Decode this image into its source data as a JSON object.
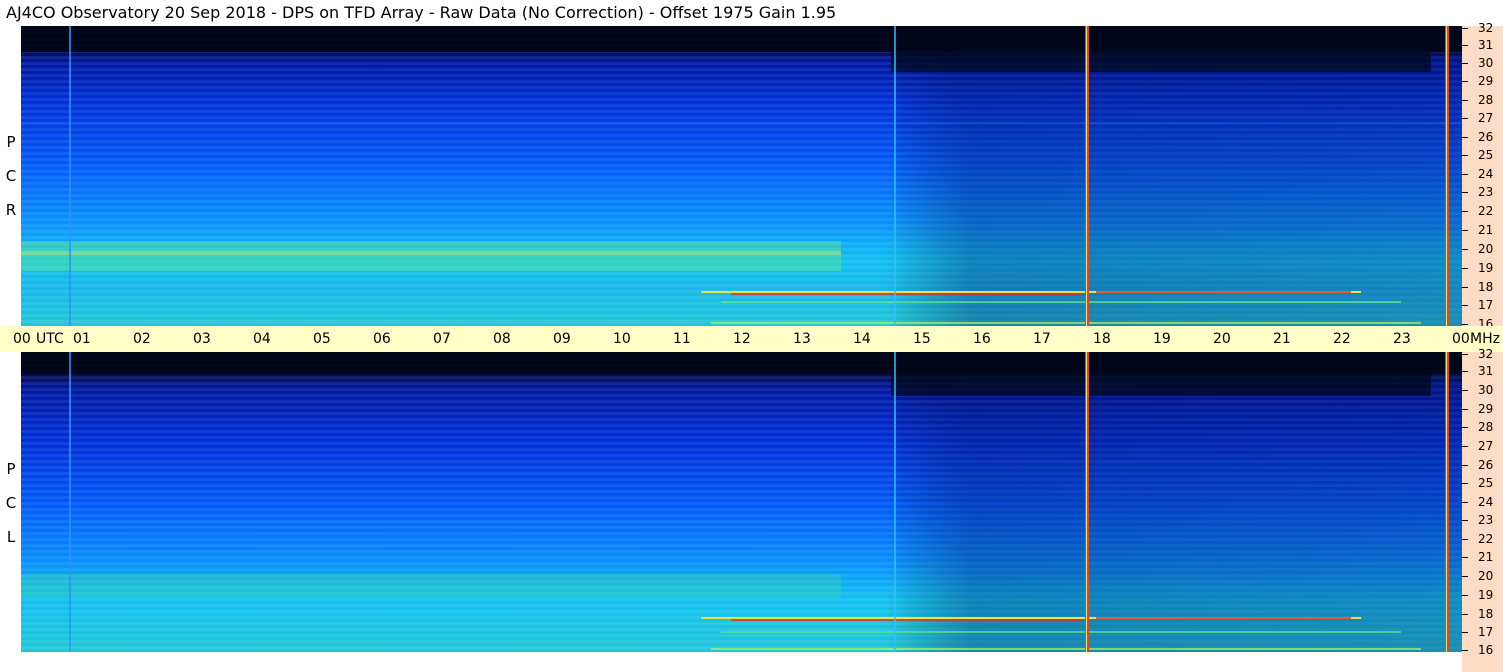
{
  "title": "AJ4CO Observatory  20 Sep 2018  -  DPS on TFD Array  -  Raw Data (No Correction)  -  Offset 1975  Gain 1.95",
  "panels": {
    "top": {
      "label": [
        "R",
        "C",
        "P"
      ]
    },
    "bottom": {
      "label": [
        "L",
        "C",
        "P"
      ]
    }
  },
  "time_axis": {
    "utc_label": "UTC",
    "unit_label": "MHz",
    "ticks": [
      "00",
      "01",
      "02",
      "03",
      "04",
      "05",
      "06",
      "07",
      "08",
      "09",
      "10",
      "11",
      "12",
      "13",
      "14",
      "15",
      "16",
      "17",
      "18",
      "19",
      "20",
      "21",
      "22",
      "23",
      "00"
    ]
  },
  "freq_axis": {
    "ticks": [
      "32",
      "31",
      "30",
      "29",
      "28",
      "27",
      "26",
      "25",
      "24",
      "23",
      "22",
      "21",
      "20",
      "19",
      "18",
      "17",
      "16"
    ]
  },
  "colors": {
    "background_dark": "#000818",
    "deep_blue": "#0020c8",
    "mid_blue": "#0060ff",
    "cyan": "#10b8ff",
    "green_cyan": "#30e8b0",
    "yellow": "#f0f040",
    "red": "#e03020",
    "axis_bg": "#fcdcc4",
    "time_bg": "#ffffc8"
  }
}
